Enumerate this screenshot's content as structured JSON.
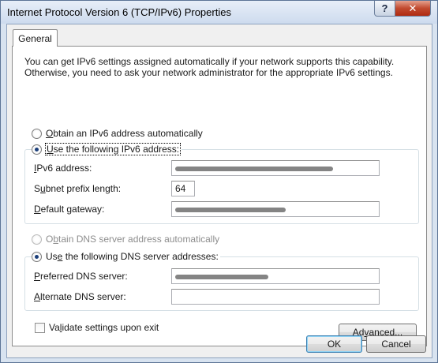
{
  "window": {
    "title": "Internet Protocol Version 6 (TCP/IPv6) Properties",
    "help_glyph": "?",
    "close_glyph": "✕"
  },
  "tabs": [
    {
      "label": "General",
      "selected": true
    }
  ],
  "intro_text": "You can get IPv6 settings assigned automatically if your network supports this capability. Otherwise, you need to ask your network administrator for the appropriate IPv6 settings.",
  "ip_section": {
    "auto_option": {
      "access_key": "O",
      "rest": "btain an IPv6 address automatically",
      "selected": false
    },
    "manual_option": {
      "access_key": "U",
      "rest": "se the following IPv6 address:",
      "selected": true
    },
    "fields": [
      {
        "access_key": "I",
        "rest": "Pv6 address:",
        "value": ""
      },
      {
        "before": "S",
        "access_key": "u",
        "rest": "bnet prefix length:",
        "value": "64"
      },
      {
        "access_key": "D",
        "rest": "efault gateway:",
        "value": ""
      }
    ]
  },
  "dns_section": {
    "auto_option": {
      "before": "O",
      "access_key": "b",
      "rest": "tain DNS server address automatically",
      "selected": false,
      "disabled": true
    },
    "manual_option": {
      "before": "Us",
      "access_key": "e",
      "rest": " the following DNS server addresses:",
      "selected": true
    },
    "fields": [
      {
        "access_key": "P",
        "rest": "referred DNS server:",
        "value": ""
      },
      {
        "access_key": "A",
        "rest": "lternate DNS server:",
        "value": ""
      }
    ]
  },
  "validate_checkbox": {
    "before": "Va",
    "access_key": "l",
    "rest": "idate settings upon exit",
    "checked": false
  },
  "buttons": {
    "advanced": {
      "before": "Ad",
      "access_key": "v",
      "rest": "anced..."
    },
    "ok": "OK",
    "cancel": "Cancel"
  }
}
